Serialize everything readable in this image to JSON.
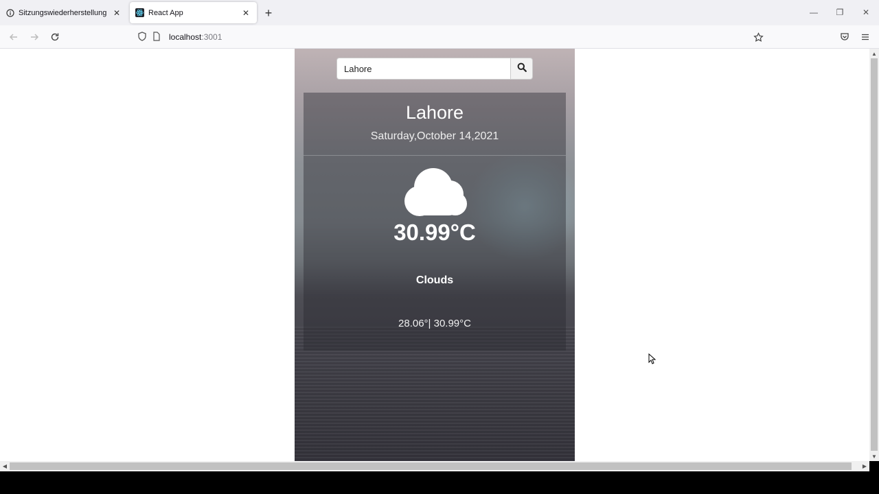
{
  "browser": {
    "tabs": [
      {
        "title": "Sitzungswiederherstellung",
        "active": false
      },
      {
        "title": "React App",
        "active": true
      }
    ],
    "url": {
      "host": "localhost",
      "port": ":3001"
    }
  },
  "search": {
    "value": "Lahore"
  },
  "weather": {
    "city": "Lahore",
    "date": "Saturday,October 14,2021",
    "temperature": "30.99°C",
    "condition": "Clouds",
    "min_max": "28.06°| 30.99°C",
    "icon": "cloud-icon"
  }
}
